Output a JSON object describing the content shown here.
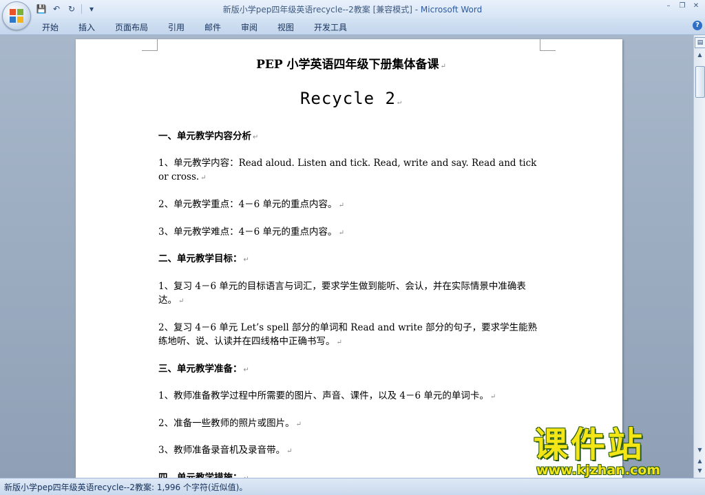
{
  "window": {
    "doc_title": "新版小学pep四年级英语recycle--2教案 [兼容模式]",
    "separator": " - ",
    "app_name": "Microsoft Word",
    "min_symbol": "–",
    "restore_symbol": "❐",
    "close_symbol": "✕"
  },
  "qat": {
    "save": "💾",
    "undo": "↶",
    "redo": "↻",
    "more": "▾"
  },
  "tabs": [
    "开始",
    "插入",
    "页面布局",
    "引用",
    "邮件",
    "审阅",
    "视图",
    "开发工具"
  ],
  "help": "?",
  "document": {
    "title": "PEP 小学英语四年级下册集体备课",
    "heading": "Recycle 2",
    "mark": "↵",
    "paragraphs": [
      {
        "text": "一、单元教学内容分析",
        "bold": true
      },
      {
        "text": "1、单元教学内容：Read aloud. Listen and tick. Read, write and say. Read and tick or cross.",
        "bold": false
      },
      {
        "text": "2、单元教学重点：4－6 单元的重点内容。",
        "bold": false
      },
      {
        "text": "3、单元教学难点：4－6 单元的重点内容。",
        "bold": false
      },
      {
        "text": "二、单元教学目标：",
        "bold": true
      },
      {
        "text": "1、复习 4－6 单元的目标语言与词汇，要求学生做到能听、会认，并在实际情景中准确表达。",
        "bold": false
      },
      {
        "text": "2、复习 4－6 单元 Let’s spell 部分的单词和 Read and write 部分的句子，要求学生能熟练地听、说、认读并在四线格中正确书写。",
        "bold": false
      },
      {
        "text": "三、单元教学准备：",
        "bold": true
      },
      {
        "text": "1、教师准备教学过程中所需要的图片、声音、课件，以及 4－6 单元的单词卡。",
        "bold": false
      },
      {
        "text": "2、准备一些教师的照片或图片。",
        "bold": false
      },
      {
        "text": "3、教师准备录音机及录音带。",
        "bold": false
      },
      {
        "text": "四、单元教学措施：",
        "bold": true
      }
    ]
  },
  "status": {
    "text": "新版小学pep四年级英语recycle--2教案: 1,996 个字符(近似值)。"
  },
  "watermark": {
    "cn": "课件站",
    "url": "www.kjzhan.com"
  },
  "colors": {
    "accent": "#2b5aa0",
    "workspace": "#9aa9bc",
    "watermark": "#f3e516"
  }
}
